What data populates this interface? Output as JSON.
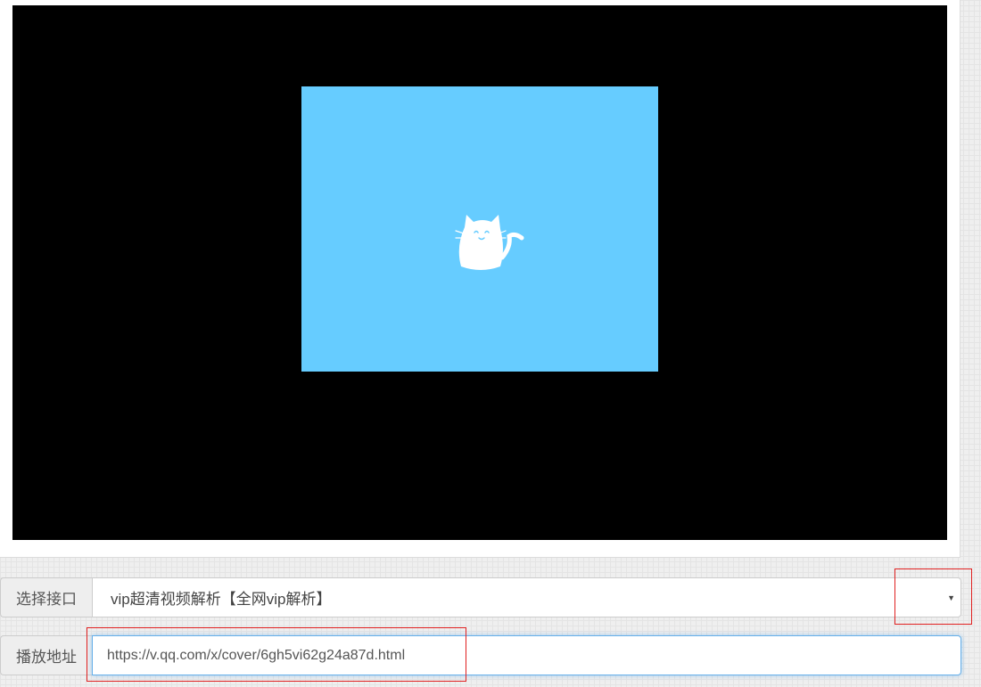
{
  "player": {
    "poster_color": "#66ccff",
    "mascot_icon": "cat-icon"
  },
  "interface_row": {
    "label": "选择接口",
    "selected": "vip超清视频解析【全网vip解析】",
    "arrow": "▼"
  },
  "address_row": {
    "label": "播放地址",
    "value": "https://v.qq.com/x/cover/6gh5vi62g24a87d.html"
  },
  "colors": {
    "highlight": "#e02020",
    "focus_border": "#66afe9"
  }
}
